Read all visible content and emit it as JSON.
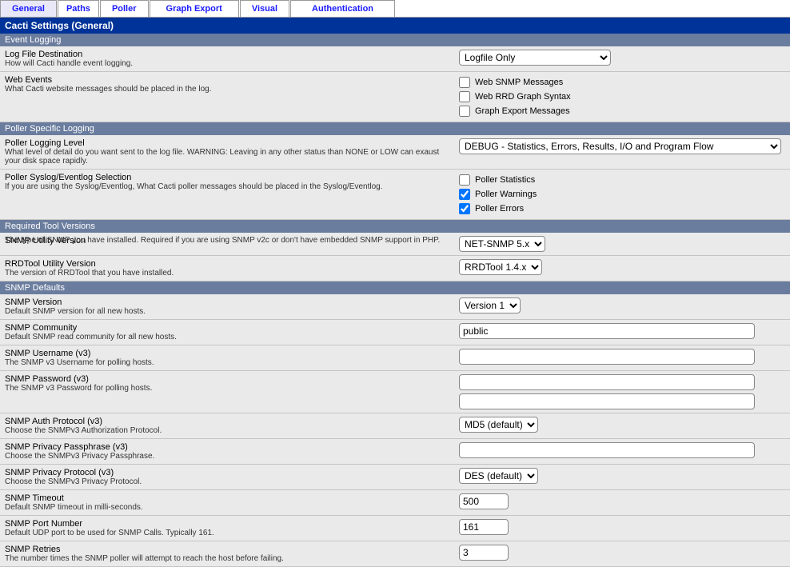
{
  "tabs": {
    "general": "General",
    "paths": "Paths",
    "poller": "Poller",
    "graph_export": "Graph Export",
    "visual": "Visual",
    "authentication": "Authentication"
  },
  "title": "Cacti Settings (General)",
  "sections": {
    "event_logging": "Event Logging",
    "poller_specific": "Poller Specific Logging",
    "required_tool": "Required Tool Versions",
    "snmp_defaults": "SNMP Defaults"
  },
  "event_logging": {
    "log_dest_title": "Log File Destination",
    "log_dest_desc": "How will Cacti handle event logging.",
    "log_dest_value": "Logfile Only",
    "web_events_title": "Web Events",
    "web_events_desc": "What Cacti website messages should be placed in the log.",
    "chk_web_snmp": "Web SNMP Messages",
    "chk_web_rrd": "Web RRD Graph Syntax",
    "chk_graph_export": "Graph Export Messages"
  },
  "poller_logging": {
    "level_title": "Poller Logging Level",
    "level_desc": "What level of detail do you want sent to the log file. WARNING: Leaving in any other status than NONE or LOW can exaust your disk space rapidly.",
    "level_value": "DEBUG - Statistics, Errors, Results, I/O and Program Flow",
    "syslog_title": "Poller Syslog/Eventlog Selection",
    "syslog_desc": "If you are using the Syslog/Eventlog, What Cacti poller messages should be placed in the Syslog/Eventlog.",
    "chk_stats": "Poller Statistics",
    "chk_warnings": "Poller Warnings",
    "chk_errors": "Poller Errors"
  },
  "required_tool": {
    "snmp_util_title": "SNMP Utility Version",
    "snmp_util_desc": "The type of SNMP you have installed. Required if you are using SNMP v2c or don't have embedded SNMP support in PHP.",
    "snmp_util_value": "NET-SNMP 5.x",
    "rrd_util_title": "RRDTool Utility Version",
    "rrd_util_desc": "The version of RRDTool that you have installed.",
    "rrd_util_value": "RRDTool 1.4.x"
  },
  "snmp_defaults": {
    "version_title": "SNMP Version",
    "version_desc": "Default SNMP version for all new hosts.",
    "version_value": "Version 1",
    "community_title": "SNMP Community",
    "community_desc": "Default SNMP read community for all new hosts.",
    "community_value": "public",
    "username_title": "SNMP Username (v3)",
    "username_desc": "The SNMP v3 Username for polling hosts.",
    "username_value": "",
    "password_title": "SNMP Password (v3)",
    "password_desc": "The SNMP v3 Password for polling hosts.",
    "password_value": "",
    "password2_value": "",
    "auth_title": "SNMP Auth Protocol (v3)",
    "auth_desc": "Choose the SNMPv3 Authorization Protocol.",
    "auth_value": "MD5 (default)",
    "priv_pass_title": "SNMP Privacy Passphrase (v3)",
    "priv_pass_desc": "Choose the SNMPv3 Privacy Passphrase.",
    "priv_pass_value": "",
    "priv_proto_title": "SNMP Privacy Protocol (v3)",
    "priv_proto_desc": "Choose the SNMPv3 Privacy Protocol.",
    "priv_proto_value": "DES (default)",
    "timeout_title": "SNMP Timeout",
    "timeout_desc": "Default SNMP timeout in milli-seconds.",
    "timeout_value": "500",
    "port_title": "SNMP Port Number",
    "port_desc": "Default UDP port to be used for SNMP Calls. Typically 161.",
    "port_value": "161",
    "retries_title": "SNMP Retries",
    "retries_desc": "The number times the SNMP poller will attempt to reach the host before failing.",
    "retries_value": "3"
  }
}
